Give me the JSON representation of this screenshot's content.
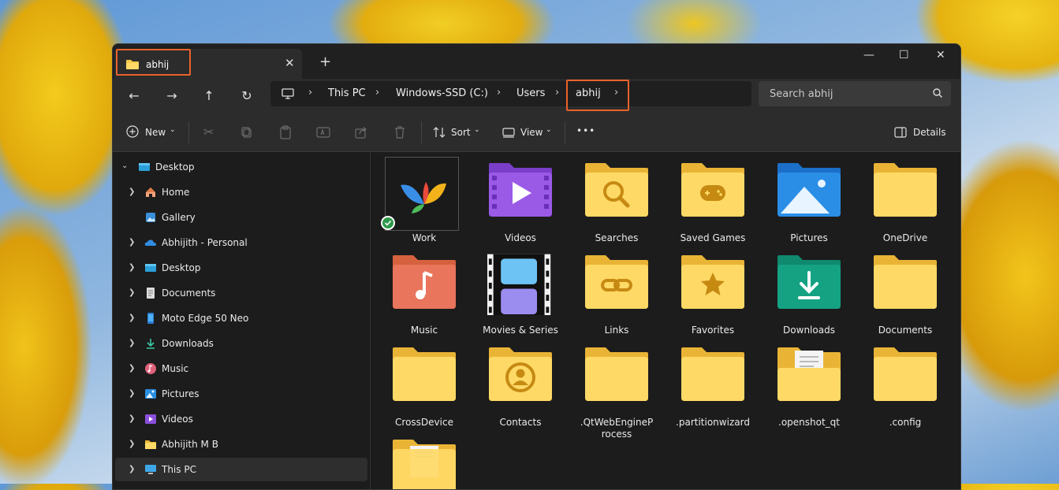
{
  "window": {
    "tab_title": "abhij",
    "new_tab": "+",
    "controls": {
      "minimize": "—",
      "maximize": "☐",
      "close": "✕"
    }
  },
  "nav": {
    "back": "←",
    "forward": "→",
    "up": "↑",
    "refresh": "↻",
    "breadcrumb": [
      "This PC",
      "Windows-SSD (C:)",
      "Users",
      "abhij"
    ],
    "search_placeholder": "Search abhij"
  },
  "toolbar": {
    "new_label": "New",
    "sort_label": "Sort",
    "view_label": "View",
    "more_label": "•••",
    "details_label": "Details"
  },
  "sidebar": {
    "items": [
      {
        "label": "Desktop",
        "icon": "desktop-icon"
      },
      {
        "label": "Home",
        "icon": "home-icon"
      },
      {
        "label": "Gallery",
        "icon": "gallery-icon"
      },
      {
        "label": "Abhijith - Personal",
        "icon": "onedrive-icon"
      },
      {
        "label": "Desktop",
        "icon": "desktop-icon"
      },
      {
        "label": "Documents",
        "icon": "documents-icon"
      },
      {
        "label": "Moto Edge 50 Neo",
        "icon": "phone-icon"
      },
      {
        "label": "Downloads",
        "icon": "downloads-icon"
      },
      {
        "label": "Music",
        "icon": "music-icon"
      },
      {
        "label": "Pictures",
        "icon": "pictures-icon"
      },
      {
        "label": "Videos",
        "icon": "videos-icon"
      },
      {
        "label": "Abhijith M B",
        "icon": "folder-icon"
      },
      {
        "label": "This PC",
        "icon": "pc-icon"
      }
    ]
  },
  "folders": [
    {
      "name": "Work",
      "icon": "work-app-icon"
    },
    {
      "name": "Videos",
      "icon": "videos-folder-icon"
    },
    {
      "name": "Searches",
      "icon": "searches-folder-icon"
    },
    {
      "name": "Saved Games",
      "icon": "saved-games-folder-icon"
    },
    {
      "name": "Pictures",
      "icon": "pictures-folder-icon"
    },
    {
      "name": "OneDrive",
      "icon": "folder-icon"
    },
    {
      "name": "Music",
      "icon": "music-folder-icon"
    },
    {
      "name": "Movies & Series",
      "icon": "movies-folder-icon"
    },
    {
      "name": "Links",
      "icon": "links-folder-icon"
    },
    {
      "name": "Favorites",
      "icon": "favorites-folder-icon"
    },
    {
      "name": "Downloads",
      "icon": "downloads-folder-icon"
    },
    {
      "name": "Documents",
      "icon": "folder-icon"
    },
    {
      "name": "CrossDevice",
      "icon": "folder-icon"
    },
    {
      "name": "Contacts",
      "icon": "contacts-folder-icon"
    },
    {
      "name": ".QtWebEngineProcess",
      "icon": "folder-icon"
    },
    {
      "name": ".partitionwizard",
      "icon": "folder-icon"
    },
    {
      "name": ".openshot_qt",
      "icon": "folder-with-files-icon"
    },
    {
      "name": ".config",
      "icon": "folder-icon"
    },
    {
      "name": "",
      "icon": "folder-with-files-icon"
    }
  ],
  "colors": {
    "highlight": "#e8632b",
    "folder": "#f6c948",
    "accent": "#60cdff"
  }
}
